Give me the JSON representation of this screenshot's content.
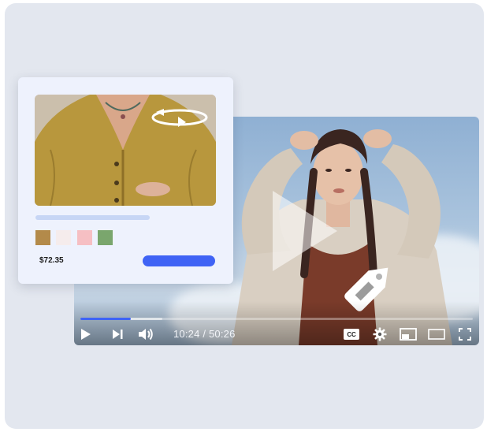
{
  "player": {
    "current_time": "10:24",
    "separator": " / ",
    "duration": "50:26",
    "progress_fraction": 0.128,
    "buffered_fraction": 0.208,
    "accent_color": "#3f63f5",
    "controls": {
      "play_icon": "play-icon",
      "next_icon": "skip-next-icon",
      "volume_icon": "volume-icon",
      "captions_label": "CC",
      "settings_icon": "gear-icon",
      "pip_icon": "picture-in-picture-icon",
      "theater_icon": "theater-mode-icon",
      "fullscreen_icon": "fullscreen-icon"
    },
    "overlay_icons": [
      "large-play-icon",
      "price-tag-icon"
    ]
  },
  "product_card": {
    "price": "$72.35",
    "rotate_icon": "rotate-360-icon",
    "swatches": [
      "#b38a4a",
      "#f5ecec",
      "#f6bfc3",
      "#7aa66d"
    ],
    "buy_button_color": "#3f63f5"
  }
}
